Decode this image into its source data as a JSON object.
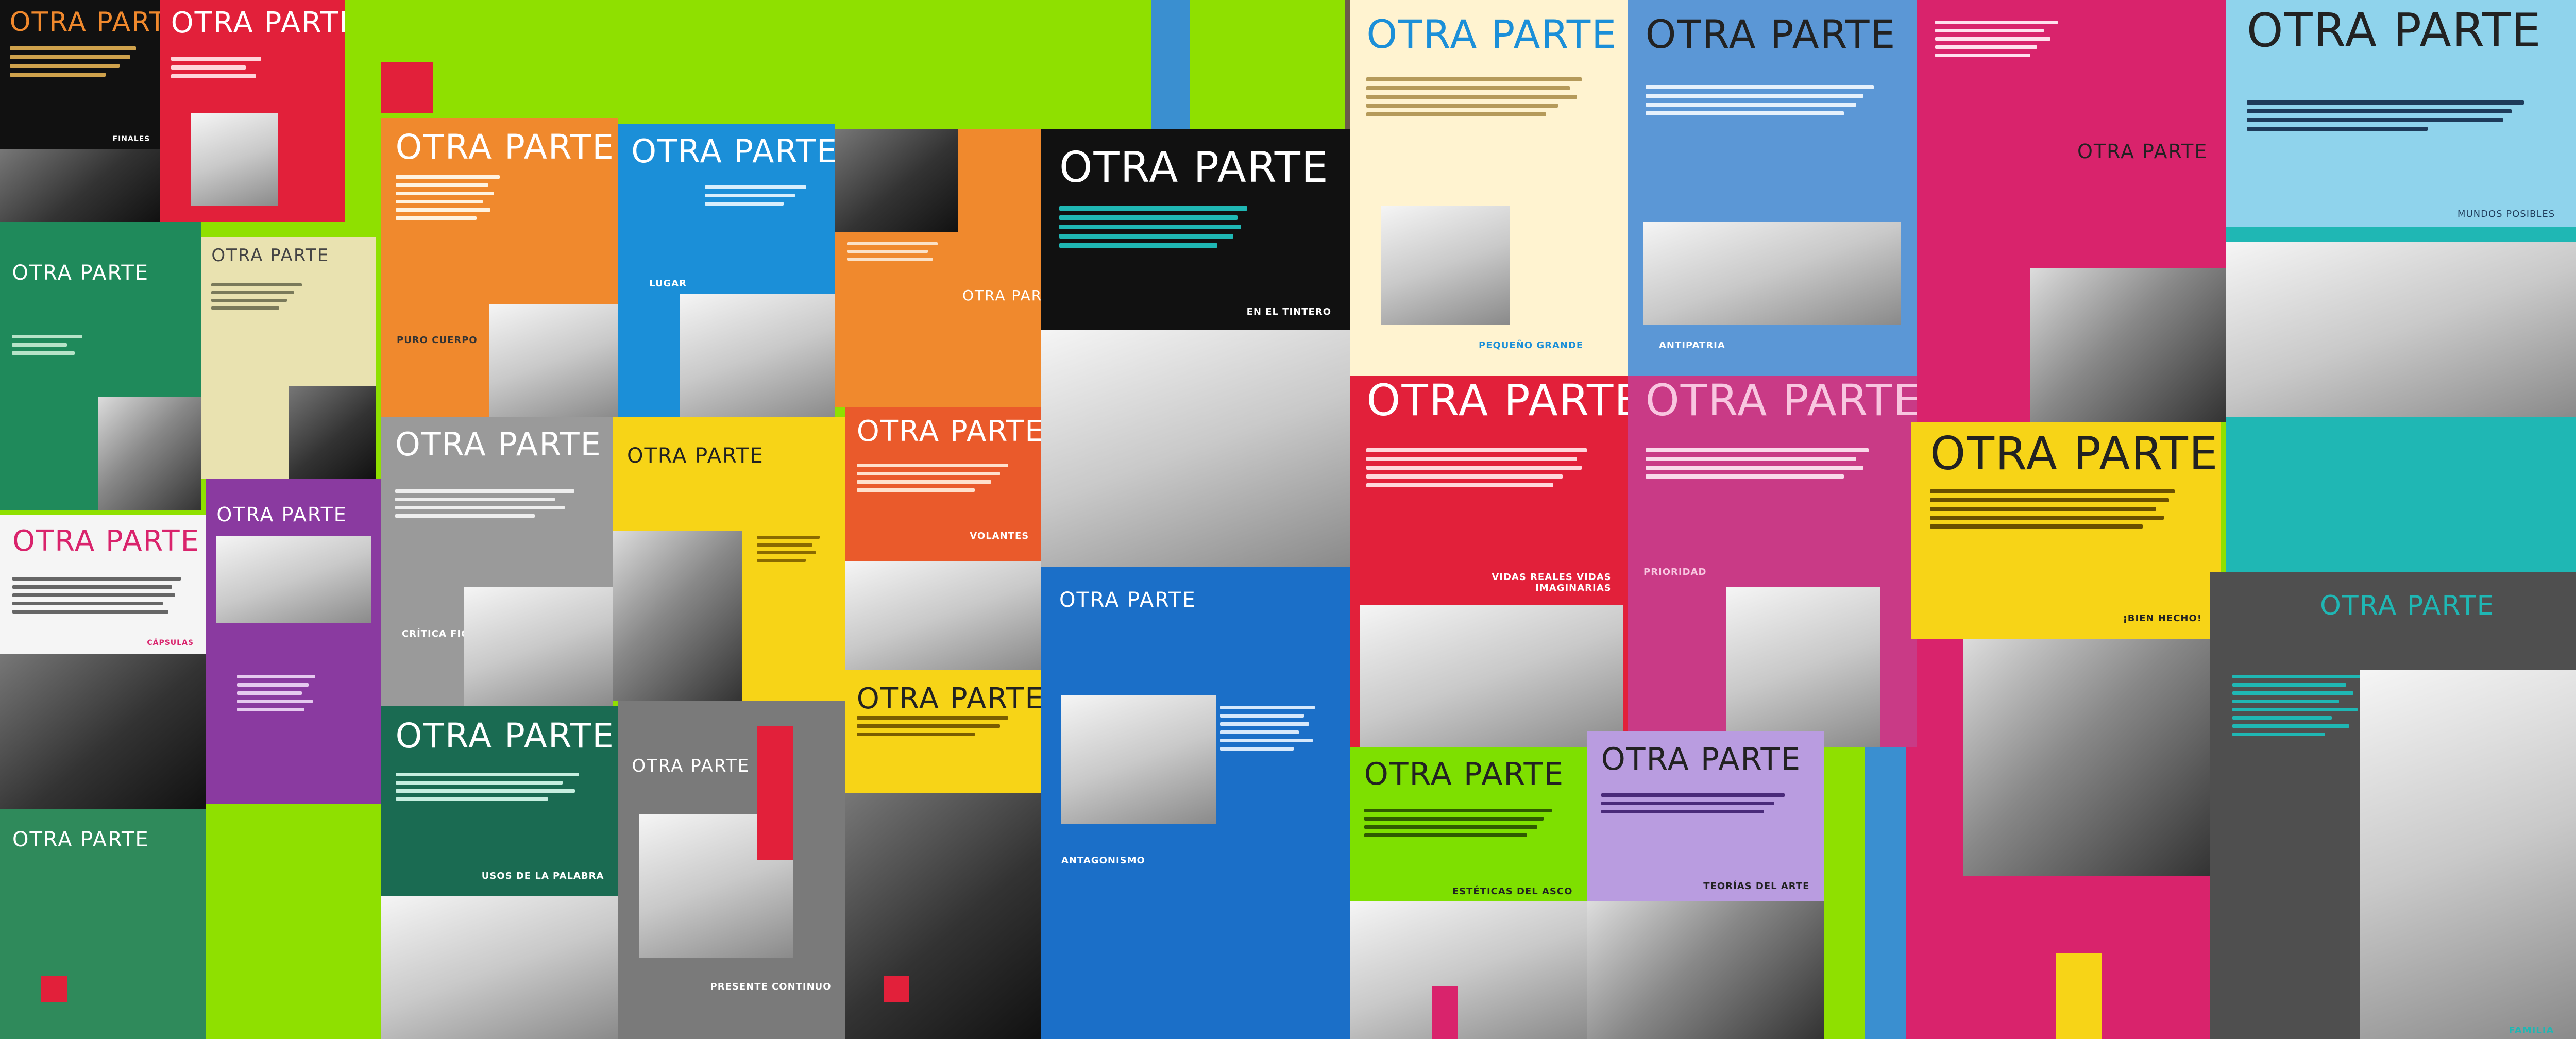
{
  "mosaic": {
    "brand": "OTRA PARTE",
    "covers": [
      {
        "title": "OTRA PARTE",
        "subtitle": "FINALES"
      },
      {
        "title": "OTRA PARTE",
        "subtitle": ""
      },
      {
        "title": "OTRA PARTE",
        "subtitle": ""
      },
      {
        "title": "OTRA PARTE",
        "subtitle": ""
      },
      {
        "title": "OTRA PARTE",
        "subtitle": "CÁPSULAS"
      },
      {
        "title": "OTRA PARTE",
        "subtitle": ""
      },
      {
        "title": "OTRA PARTE",
        "subtitle": "PURO CUERPO"
      },
      {
        "title": "OTRA PARTE",
        "subtitle": "LUGAR"
      },
      {
        "title": "OTRA PARTE",
        "subtitle": ""
      },
      {
        "title": "OTRA PARTE",
        "subtitle": "EN EL TINTERO"
      },
      {
        "title": "OTRA PARTE",
        "subtitle": "CRÍTICA FICCIÓN"
      },
      {
        "title": "OTRA PARTE",
        "subtitle": ""
      },
      {
        "title": "OTRA PARTE",
        "subtitle": "VOLANTES"
      },
      {
        "title": "OTRA PARTE",
        "subtitle": "ANTAGONISMO"
      },
      {
        "title": "OTRA PARTE",
        "subtitle": "USOS DE LA PALABRA"
      },
      {
        "title": "OTRA PARTE",
        "subtitle": "PRESENTE CONTINUO"
      },
      {
        "title": "OTRA PARTE",
        "subtitle": ""
      },
      {
        "title": "OTRA PARTE",
        "subtitle": "PEQUEÑO GRANDE"
      },
      {
        "title": "OTRA PARTE",
        "subtitle": "ANTIPATRIA"
      },
      {
        "title": "OTRA PARTE",
        "subtitle": "VIDAS REALES VIDAS IMAGINARIAS"
      },
      {
        "title": "OTRA PARTE",
        "subtitle": "PRIORIDAD"
      },
      {
        "title": "OTRA PARTE",
        "subtitle": ""
      },
      {
        "title": "OTRA PARTE",
        "subtitle": "ESTÉTICAS DEL ASCO"
      },
      {
        "title": "OTRA PARTE",
        "subtitle": "TEORÍAS DEL ARTE"
      },
      {
        "title": "OTRA PARTE",
        "subtitle": "MUNDOS POSIBLES"
      },
      {
        "title": "OTRA PARTE",
        "subtitle": "¡BIEN HECHO!"
      },
      {
        "title": "OTRA PARTE",
        "subtitle": "FAMILIA"
      },
      {
        "title": "OTRA PARTE",
        "subtitle": ""
      }
    ],
    "colors": {
      "background": "#8fe000",
      "black": "#111111",
      "red": "#e2203a",
      "orange": "#f0892d",
      "blue": "#1b8fd8",
      "yellow": "#f7d417",
      "green": "#1f8a5b",
      "purple": "#8a3aa0",
      "magenta": "#d9236c",
      "teal": "#1fb7b4",
      "cream": "#fff3d0",
      "gray": "#6f6f6f"
    }
  }
}
